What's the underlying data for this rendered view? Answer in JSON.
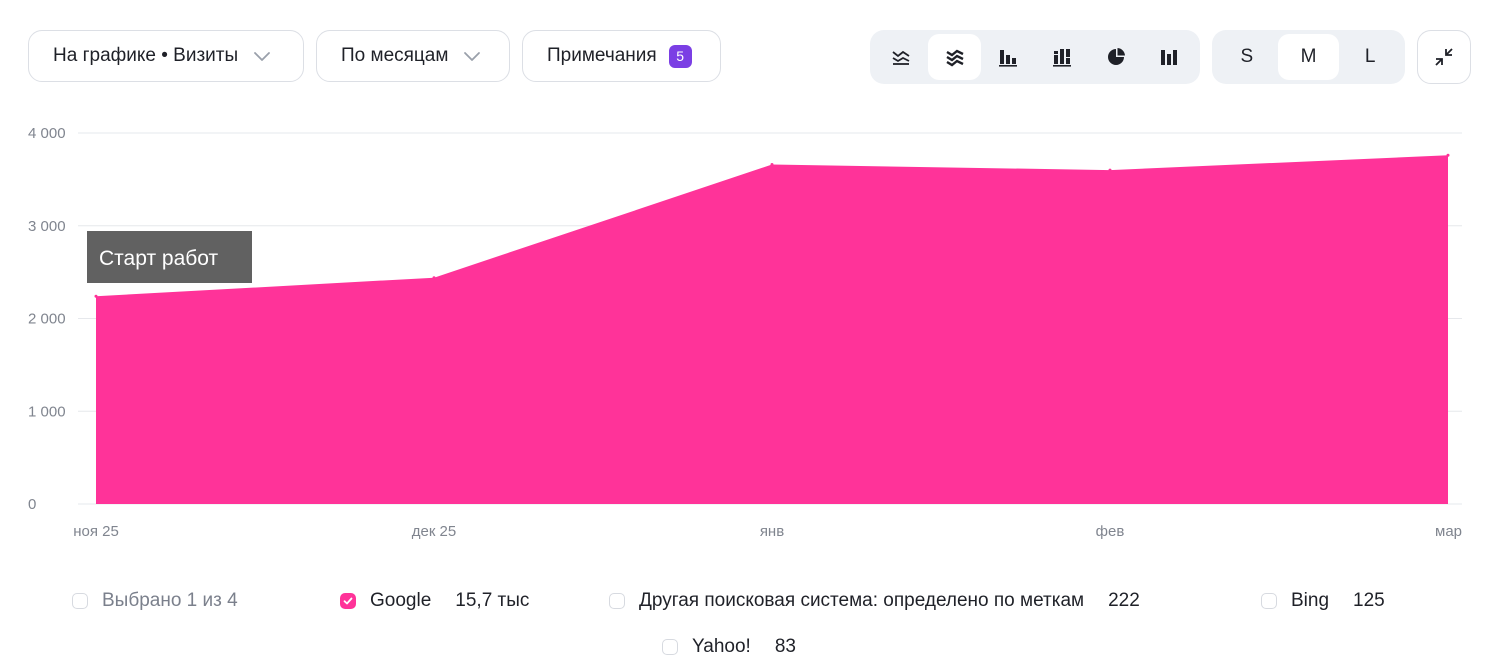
{
  "toolbar": {
    "chart_metric_label": "На графике • Визиты",
    "period_label": "По месяцам",
    "notes_label": "Примечания",
    "notes_count": "5",
    "chart_types": [
      {
        "icon": "area-unstacked-icon",
        "active": false
      },
      {
        "icon": "area-stacked-icon",
        "active": true
      },
      {
        "icon": "bar-icon",
        "active": false
      },
      {
        "icon": "stacked-bar-icon",
        "active": false
      },
      {
        "icon": "pie-icon",
        "active": false
      },
      {
        "icon": "column-icon",
        "active": false
      }
    ],
    "sizes": [
      {
        "label": "S",
        "active": false
      },
      {
        "label": "M",
        "active": true
      },
      {
        "label": "L",
        "active": false
      }
    ],
    "collapse_icon": "collapse-icon"
  },
  "colors": {
    "series": "#ff3399",
    "accent": "#7b3fe4",
    "annotation_bg": "#616161"
  },
  "chart_data": {
    "type": "area",
    "x": [
      "ноя 25",
      "дек 25",
      "янв",
      "фев",
      "мар"
    ],
    "series": [
      {
        "name": "Google",
        "values": [
          2240,
          2440,
          3660,
          3600,
          3760
        ]
      }
    ],
    "yticks": [
      "0",
      "1 000",
      "2 000",
      "3 000",
      "4 000"
    ],
    "ylim": [
      0,
      4000
    ],
    "grid": true,
    "annotation": {
      "x": "ноя 25",
      "text": "Старт работ"
    }
  },
  "legend": {
    "selected_label": "Выбрано 1 из 4",
    "items": [
      {
        "name": "Google",
        "value": "15,7 тыс",
        "checked": true
      },
      {
        "name": "Другая поисковая система: определено по меткам",
        "value": "222",
        "checked": false
      },
      {
        "name": "Bing",
        "value": "125",
        "checked": false
      },
      {
        "name": "Yahoo!",
        "value": "83",
        "checked": false
      }
    ]
  }
}
